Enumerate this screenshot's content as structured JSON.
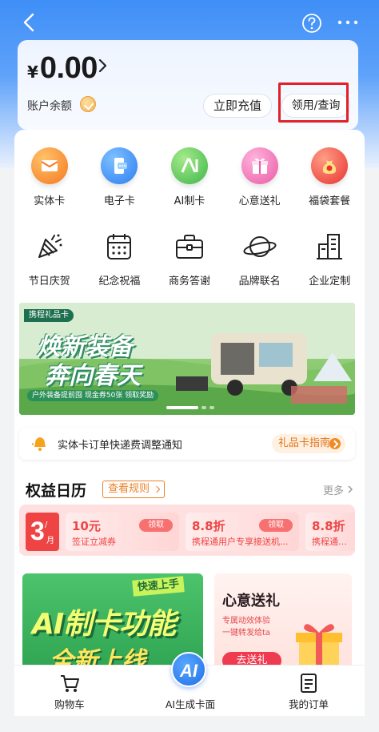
{
  "header": {
    "back_icon": "chevron-left-icon",
    "help_icon": "question-circle-icon",
    "more_icon": "ellipsis-icon"
  },
  "balance": {
    "symbol": "¥",
    "amount": "0.00",
    "label": "账户余额",
    "recharge_label": "立即充值",
    "claim_label": "领用/查询",
    "highlight_color": "#e0202a"
  },
  "grid_row1": [
    {
      "label": "实体卡",
      "icon": "physical-card-icon",
      "color": "#f58b28"
    },
    {
      "label": "电子卡",
      "icon": "e-card-icon",
      "color": "#3a8ff6"
    },
    {
      "label": "AI制卡",
      "icon": "ai-card-icon",
      "color": "#52c45b"
    },
    {
      "label": "心意送礼",
      "icon": "gift-icon",
      "color": "#f36fa3"
    },
    {
      "label": "福袋套餐",
      "icon": "lucky-bag-icon",
      "color": "#f04444"
    }
  ],
  "grid_row2": [
    {
      "label": "节日庆贺",
      "icon": "party-popper-icon"
    },
    {
      "label": "纪念祝福",
      "icon": "calendar-icon"
    },
    {
      "label": "商务答谢",
      "icon": "briefcase-icon"
    },
    {
      "label": "品牌联名",
      "icon": "planet-icon"
    },
    {
      "label": "企业定制",
      "icon": "building-icon"
    }
  ],
  "banner": {
    "logo": "携程礼品卡",
    "title_line1": "焕新装备",
    "title_line2": "奔向春天",
    "subtitle": "户外装备提前囤  现金券50张  领取奖励"
  },
  "notice": {
    "text": "实体卡订单快递费调整通知",
    "guide_label": "礼品卡指南"
  },
  "benefits": {
    "title": "权益日历",
    "rules_label": "查看规则",
    "more_label": "更多",
    "date_day": "3",
    "date_slash": "/",
    "date_month": "月",
    "coupons": [
      {
        "title": "10元",
        "desc": "签证立减券",
        "btn": "领取"
      },
      {
        "title": "8.8折",
        "desc": "携程通用户专享接送机...",
        "btn": "领取"
      },
      {
        "title": "8.8折",
        "desc": "携程通用户...",
        "btn": ""
      }
    ]
  },
  "promo_left": {
    "tag": "快速上手",
    "title": "AI制卡功能",
    "subtitle": "全新上线"
  },
  "promo_right": {
    "title": "心意送礼",
    "desc_line1": "专属动效体验",
    "desc_line2": "一键转发给ta",
    "button": "去送礼"
  },
  "bottom_nav": {
    "cart_label": "购物车",
    "ai_label": "AI生成卡面",
    "ai_badge": "AI",
    "orders_label": "我的订单"
  }
}
